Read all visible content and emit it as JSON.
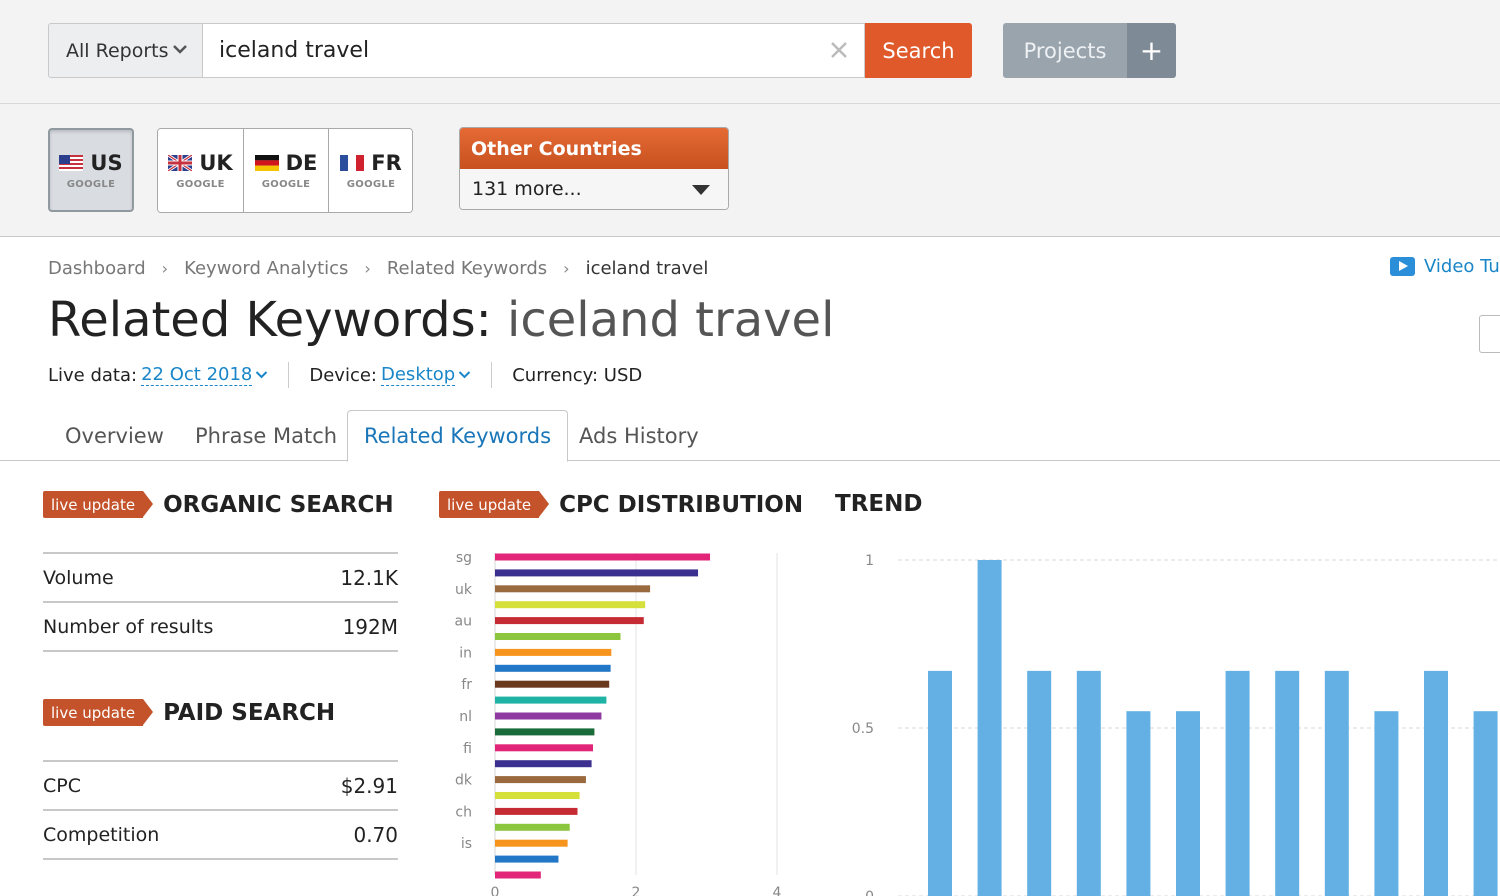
{
  "search": {
    "reports_label": "All Reports",
    "query": "iceland travel",
    "button": "Search",
    "projects": "Projects",
    "plus": "+"
  },
  "countries": {
    "us": {
      "code": "US",
      "engine": "GOOGLE"
    },
    "uk": {
      "code": "UK",
      "engine": "GOOGLE"
    },
    "de": {
      "code": "DE",
      "engine": "GOOGLE"
    },
    "fr": {
      "code": "FR",
      "engine": "GOOGLE"
    },
    "other_title": "Other Countries",
    "other_selected": "131 more..."
  },
  "breadcrumb": [
    "Dashboard",
    "Keyword Analytics",
    "Related Keywords",
    "iceland travel"
  ],
  "video_label": "Video Tu",
  "title": {
    "prefix": "Related Keywords:",
    "keyword": "iceland travel"
  },
  "meta": {
    "live_label": "Live data:",
    "live_value": "22 Oct 2018",
    "device_label": "Device:",
    "device_value": "Desktop",
    "currency": "Currency: USD"
  },
  "tabs": [
    "Overview",
    "Phrase Match",
    "Related Keywords",
    "Ads History"
  ],
  "badge": "live update",
  "organic": {
    "title": "ORGANIC SEARCH",
    "rows": [
      {
        "label": "Volume",
        "value": "12.1K"
      },
      {
        "label": "Number of results",
        "value": "192M"
      }
    ]
  },
  "paid": {
    "title": "PAID SEARCH",
    "rows": [
      {
        "label": "CPC",
        "value": "$2.91"
      },
      {
        "label": "Competition",
        "value": "0.70"
      }
    ]
  },
  "cpc_title": "CPC DISTRIBUTION",
  "trend_title": "TREND",
  "chart_data": [
    {
      "type": "bar",
      "orientation": "horizontal",
      "categories": [
        "sg",
        "",
        "uk",
        "",
        "au",
        "",
        "in",
        "",
        "fr",
        "",
        "nl",
        "",
        "fi",
        "",
        "dk",
        "",
        "ch",
        "",
        "is",
        ""
      ],
      "values": [
        3.05,
        2.88,
        2.2,
        2.13,
        2.11,
        1.78,
        1.65,
        1.64,
        1.62,
        1.58,
        1.51,
        1.41,
        1.39,
        1.37,
        1.29,
        1.2,
        1.17,
        1.06,
        1.03,
        0.9,
        0.65
      ],
      "bar_colors": [
        "#e3257a",
        "#3b2f8f",
        "#9a6a3e",
        "#d6e03a",
        "#c62b33",
        "#8cc63f",
        "#f7941d",
        "#2277c7",
        "#6b3a1e",
        "#1fb3a6",
        "#8e3aa0",
        "#1a6b3a",
        "#e3257a",
        "#3b2f8f",
        "#9a6a3e",
        "#d6e03a",
        "#c62b33",
        "#8cc63f",
        "#f7941d",
        "#2277c7"
      ],
      "xlim": [
        0,
        4
      ],
      "xticks": [
        "0",
        "2",
        "4"
      ]
    },
    {
      "type": "bar",
      "values": [
        0.67,
        1.0,
        0.67,
        0.67,
        0.55,
        0.55,
        0.67,
        0.67,
        0.67,
        0.55,
        0.67,
        0.55
      ],
      "ylim": [
        0,
        1
      ],
      "yticks": [
        "1",
        "0.5",
        "0"
      ],
      "color": "#64b0e4"
    }
  ]
}
